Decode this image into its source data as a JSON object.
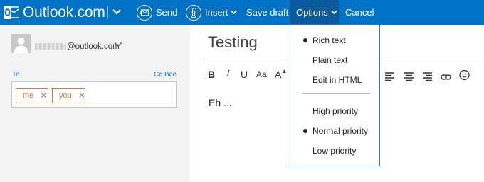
{
  "app": {
    "brand": "Outlook.com"
  },
  "toolbar": {
    "send_label": "Send",
    "insert_label": "Insert",
    "save_draft_label": "Save draft",
    "options_label": "Options",
    "cancel_label": "Cancel"
  },
  "account": {
    "email_suffix": "@outlook.com"
  },
  "recipients": {
    "to_label": "To",
    "cc_bcc_label": "Cc Bcc",
    "chips": [
      "me",
      "you"
    ],
    "remove_glyph": "✕"
  },
  "compose": {
    "subject": "Testing",
    "body": "Eh ..."
  },
  "format_toolbar": {
    "bold": "B",
    "italic": "I",
    "underline": "U",
    "font_size": "Aa"
  },
  "options_menu": {
    "items": [
      {
        "label": "Rich text",
        "selected": true
      },
      {
        "label": "Plain text",
        "selected": false
      },
      {
        "label": "Edit in HTML",
        "selected": false
      },
      {
        "label": "High priority",
        "selected": false
      },
      {
        "label": "Normal priority",
        "selected": true
      },
      {
        "label": "Low priority",
        "selected": false
      }
    ]
  },
  "colors": {
    "topbar": "#0072c6",
    "topbar_active": "#0b5a9c",
    "link": "#0072c6",
    "chip": "#d5763c",
    "left_pane": "#f3f3f3"
  }
}
